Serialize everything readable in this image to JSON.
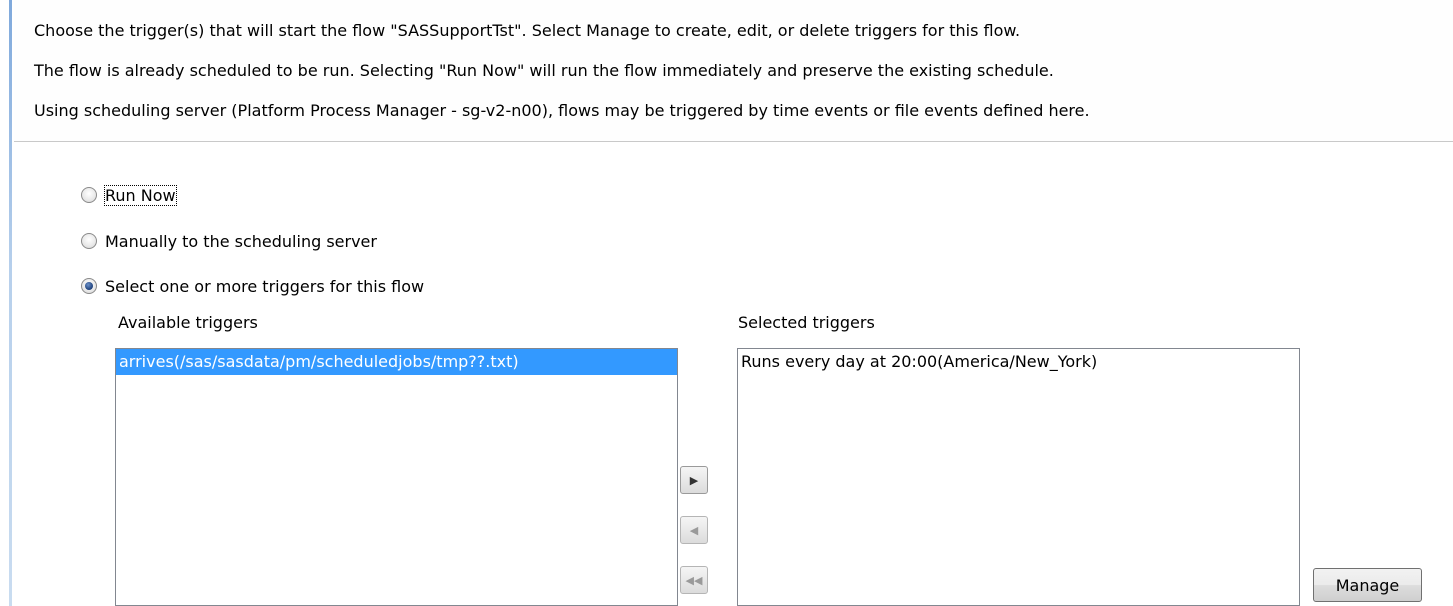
{
  "header": {
    "line1": "Choose the trigger(s) that will start the flow \"SASSupportTst\".  Select Manage to create, edit, or delete triggers for this flow.",
    "line2": "The flow is already scheduled to be run.  Selecting \"Run Now\" will run the flow immediately and preserve the existing schedule.",
    "line3": "Using scheduling server (Platform Process Manager - sg-v2-n00), flows may be triggered by time events or file events defined here."
  },
  "options": {
    "run_now": "Run Now",
    "manual": "Manually to the scheduling server",
    "select_triggers": "Select one or more triggers for this flow",
    "selected": "select_triggers"
  },
  "available": {
    "label": "Available triggers",
    "items": [
      "arrives(/sas/sasdata/pm/scheduledjobs/tmp??.txt)"
    ]
  },
  "selected_list": {
    "label": "Selected triggers",
    "items": [
      "Runs every day at 20:00(America/New_York)"
    ]
  },
  "buttons": {
    "add_icon": "arrow-right-icon",
    "remove_icon": "arrow-left-icon",
    "remove_all_icon": "double-arrow-left-icon",
    "manage": "Manage"
  }
}
